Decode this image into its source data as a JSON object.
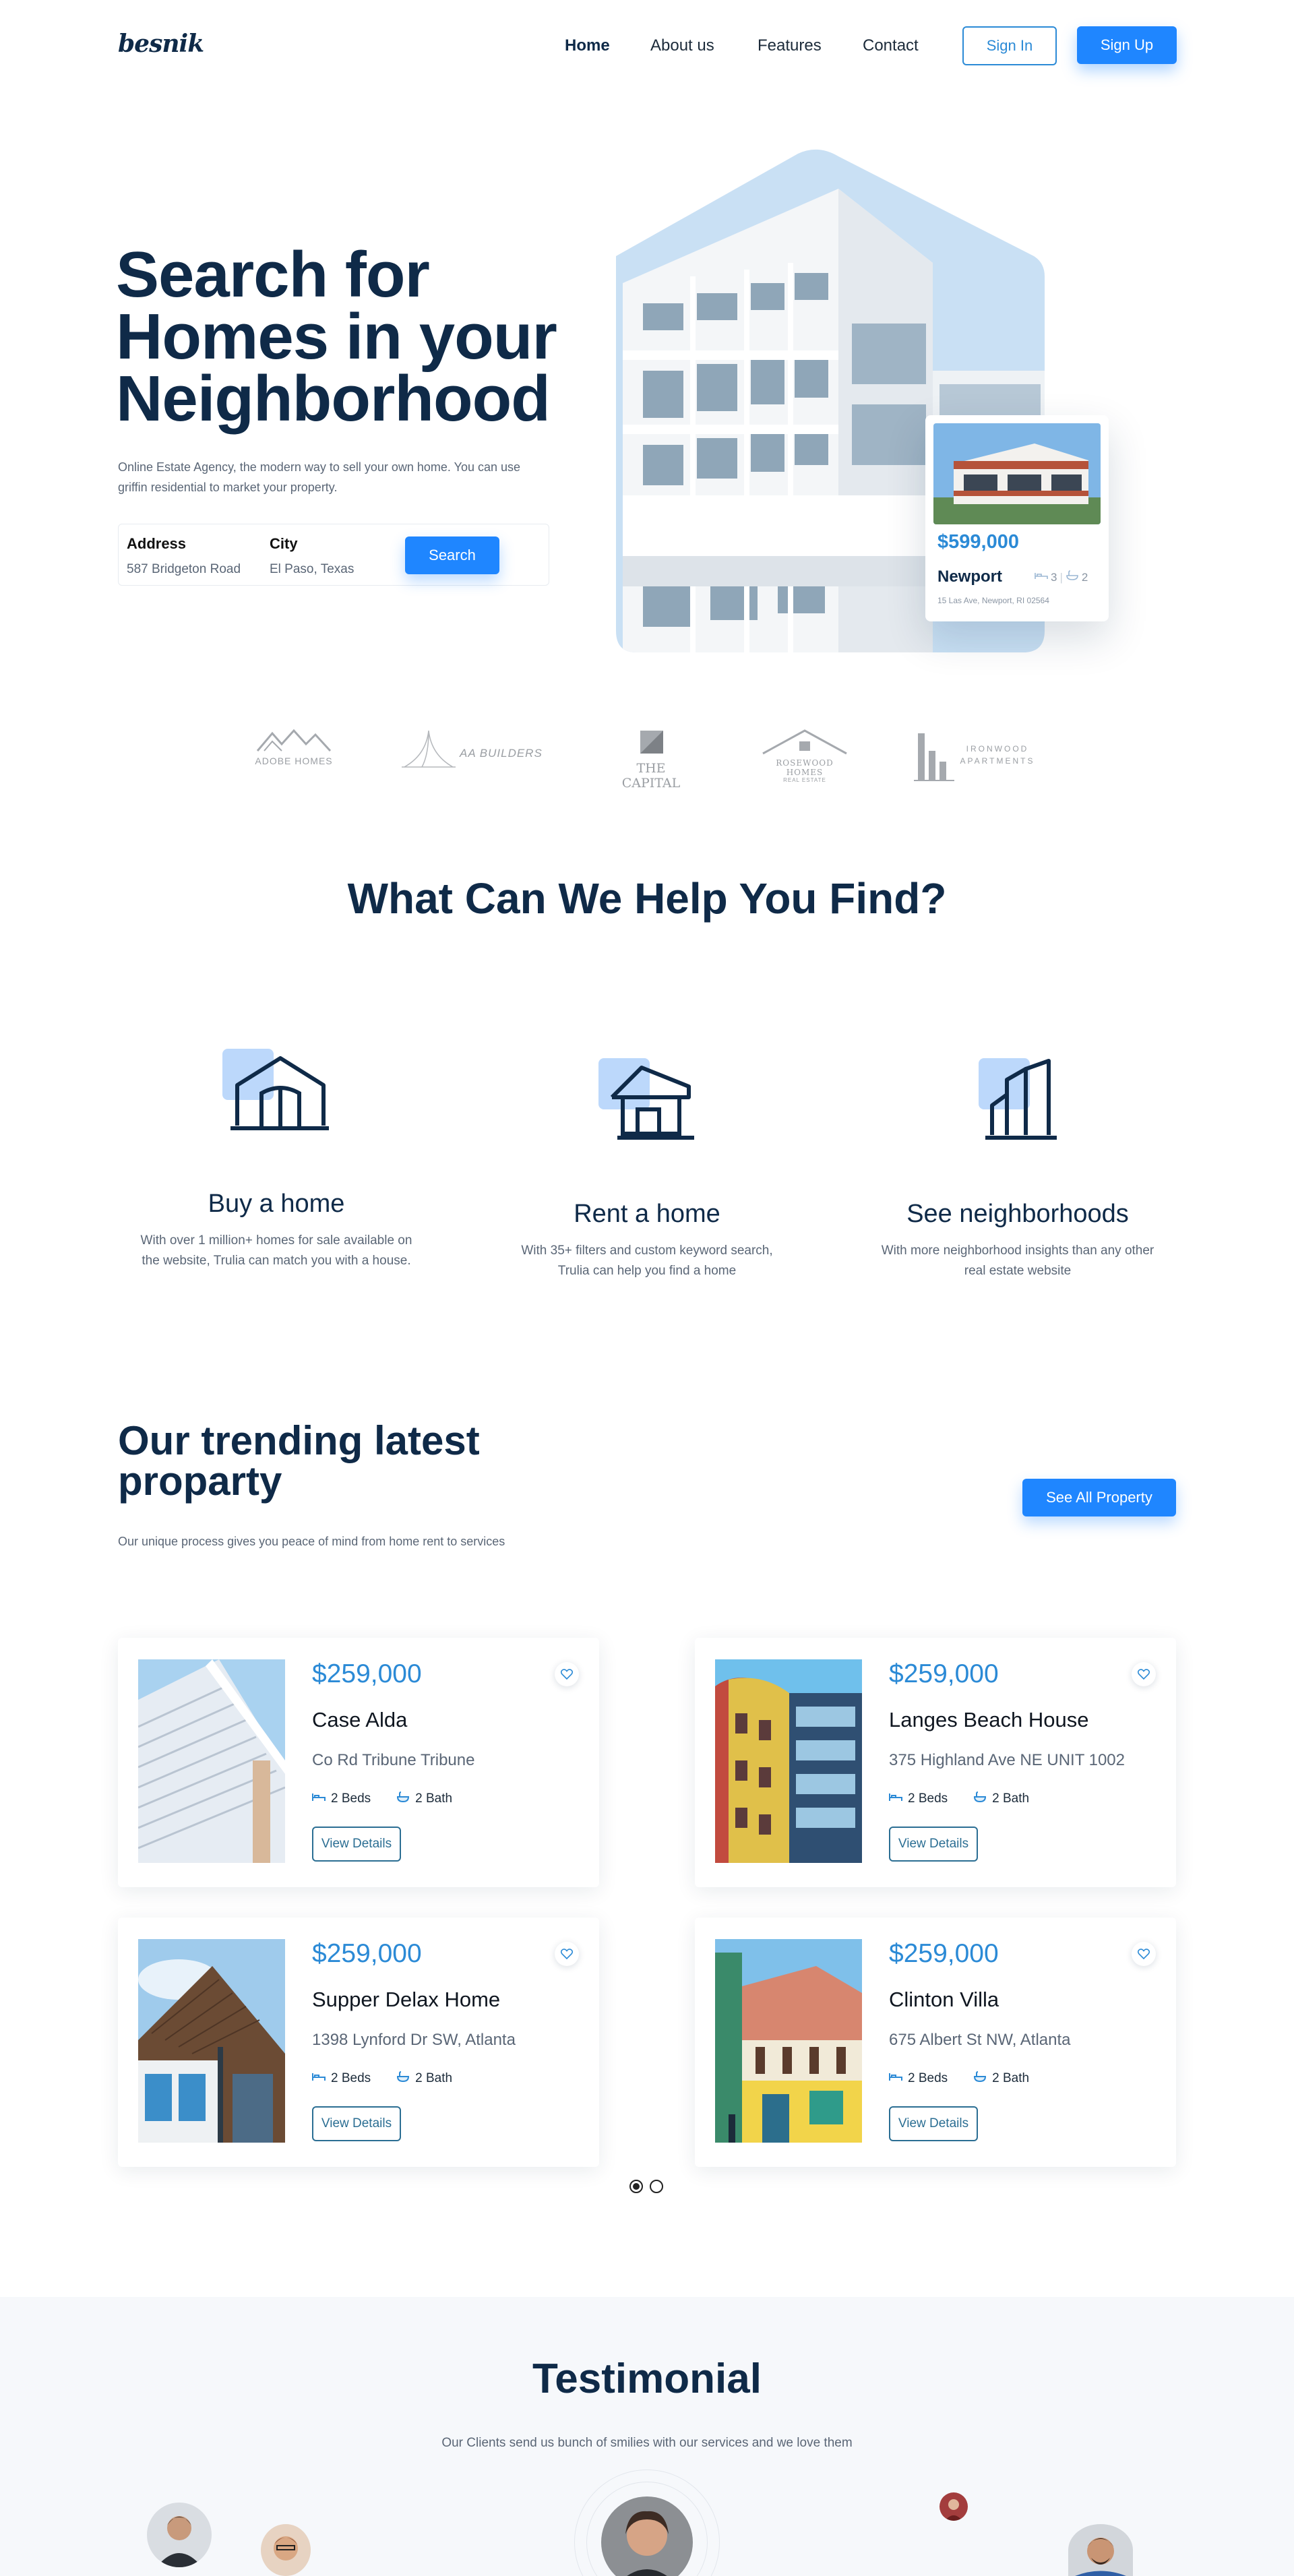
{
  "nav": {
    "logo": "besnik",
    "links": [
      "Home",
      "About us",
      "Features",
      "Contact"
    ],
    "signin": "Sign In",
    "signup": "Sign Up"
  },
  "hero": {
    "title": "Search for Homes in your Neighborhood",
    "subtitle": "Online Estate Agency, the modern way to sell your own home. You can use griffin residential to market your property.",
    "search": {
      "address_label": "Address",
      "address_value": "587 Bridgeton Road",
      "city_label": "City",
      "city_value": "El Paso, Texas",
      "button": "Search"
    },
    "listing": {
      "price": "$599,000",
      "name": "Newport",
      "beds": "3",
      "baths": "2",
      "address": "15 Las Ave, Newport, RI 02564"
    }
  },
  "brands": [
    "ADOBE HOMES",
    "AA BUILDERS",
    "THE CAPITAL",
    "ROSEWOOD HOMES",
    "IRONWOOD APARTMENTS"
  ],
  "brand_tagline": "REAL ESTATE",
  "services": {
    "title": "What Can We Help You Find?",
    "items": [
      {
        "title": "Buy a home",
        "desc": "With over 1 million+ homes for sale available on the website, Trulia can match you with a house."
      },
      {
        "title": "Rent a home",
        "desc": "With 35+ filters and custom keyword search, Trulia can help you find a home"
      },
      {
        "title": "See neighborhoods",
        "desc": "With more neighborhood insights than any other real estate website"
      }
    ]
  },
  "trending": {
    "title": "Our trending latest proparty",
    "subtitle": "Our unique process gives you peace of mind from home rent to services",
    "see_all": "See All Property",
    "properties": [
      {
        "price": "$259,000",
        "name": "Case Alda",
        "address": "Co Rd Tribune Tribune",
        "beds": "2 Beds",
        "baths": "2 Bath",
        "button": "View Details"
      },
      {
        "price": "$259,000",
        "name": "Langes Beach House",
        "address": "375 Highland Ave NE UNIT 1002",
        "beds": "2 Beds",
        "baths": "2 Bath",
        "button": "View Details"
      },
      {
        "price": "$259,000",
        "name": "Supper Delax Home",
        "address": "1398 Lynford Dr SW, Atlanta",
        "beds": "2 Beds",
        "baths": "2 Bath",
        "button": "View Details"
      },
      {
        "price": "$259,000",
        "name": "Clinton Villa",
        "address": "675 Albert St NW, Atlanta",
        "beds": "2 Beds",
        "baths": "2 Bath",
        "button": "View Details"
      }
    ]
  },
  "testimonial": {
    "title": "Testimonial",
    "subtitle": "Our Clients send us bunch of smilies with our services and we love them"
  },
  "colors": {
    "primary": "#1f86ff",
    "navy": "#0f2a48",
    "accent_text": "#2b8ad6",
    "icon_bg": "#bcd8fb"
  }
}
